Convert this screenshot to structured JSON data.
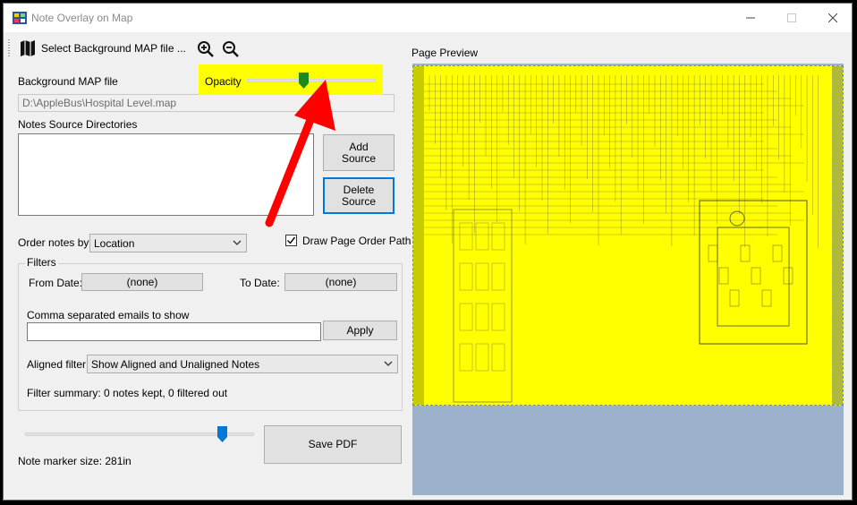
{
  "window": {
    "title": "Note Overlay on Map"
  },
  "toolbar": {
    "select_map_label": "Select Background MAP file ...",
    "zoom_in_icon": "zoom-in-icon",
    "zoom_out_icon": "zoom-out-icon"
  },
  "background_map": {
    "label": "Background MAP file",
    "path": "D:\\AppleBus\\Hospital Level.map"
  },
  "opacity": {
    "label": "Opacity",
    "value": 0.44
  },
  "notes_sources": {
    "label": "Notes Source Directories",
    "items": [],
    "add_label": "Add\nSource",
    "delete_label": "Delete\nSource"
  },
  "order": {
    "label": "Order notes by",
    "selected": "Location",
    "draw_path_label": "Draw Page Order Path",
    "draw_path_checked": true
  },
  "filters": {
    "title": "Filters",
    "from_label": "From Date:",
    "from_value": "(none)",
    "to_label": "To Date:",
    "to_value": "(none)",
    "emails_label": "Comma separated emails to show",
    "emails_value": "",
    "apply_label": "Apply",
    "aligned_label": "Aligned filter:",
    "aligned_selected": "Show Aligned and Unaligned Notes",
    "summary": "Filter summary: 0 notes kept, 0 filtered out"
  },
  "marker": {
    "size_label": "Note marker size: 281in",
    "value": 0.86
  },
  "save_pdf_label": "Save PDF",
  "preview": {
    "label": "Page Preview"
  },
  "colors": {
    "highlight": "#ffff00",
    "arrow": "#ff0000",
    "preview_bg": "#9cb2cc",
    "accent": "#0078d7",
    "opacity_thumb": "#1e8a1e"
  }
}
